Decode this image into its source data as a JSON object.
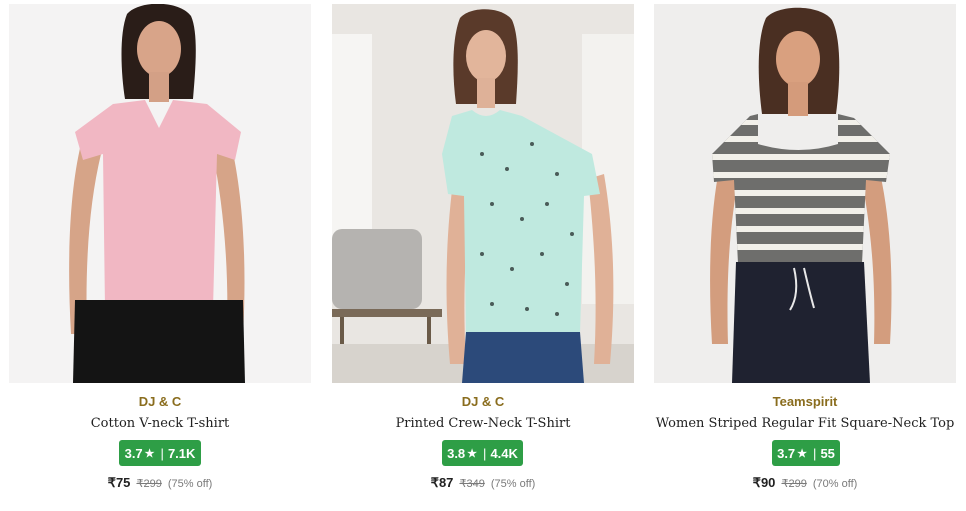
{
  "products": [
    {
      "brand": "DJ & C",
      "title": "Cotton V-neck T-shirt",
      "rating": "3.7",
      "reviews": "7.1K",
      "price": "₹75",
      "mrp": "₹299",
      "discount": "(75% off)",
      "image_alt": "Woman wearing a pink cotton V-neck t-shirt"
    },
    {
      "brand": "DJ & C",
      "title": "Printed Crew-Neck T-Shirt",
      "rating": "3.8",
      "reviews": "4.4K",
      "price": "₹87",
      "mrp": "₹349",
      "discount": "(75% off)",
      "image_alt": "Woman wearing a mint printed crew-neck t-shirt"
    },
    {
      "brand": "Teamspirit",
      "title": "Women Striped Regular Fit Square-Neck Top",
      "rating": "3.7",
      "reviews": "55",
      "price": "₹90",
      "mrp": "₹299",
      "discount": "(70% off)",
      "image_alt": "Woman wearing a grey striped square-neck top"
    }
  ],
  "icons": {
    "rating_star": "star-icon"
  },
  "colors": {
    "brand_text": "#8a6d1e",
    "rating_badge": "#2e9e46"
  }
}
